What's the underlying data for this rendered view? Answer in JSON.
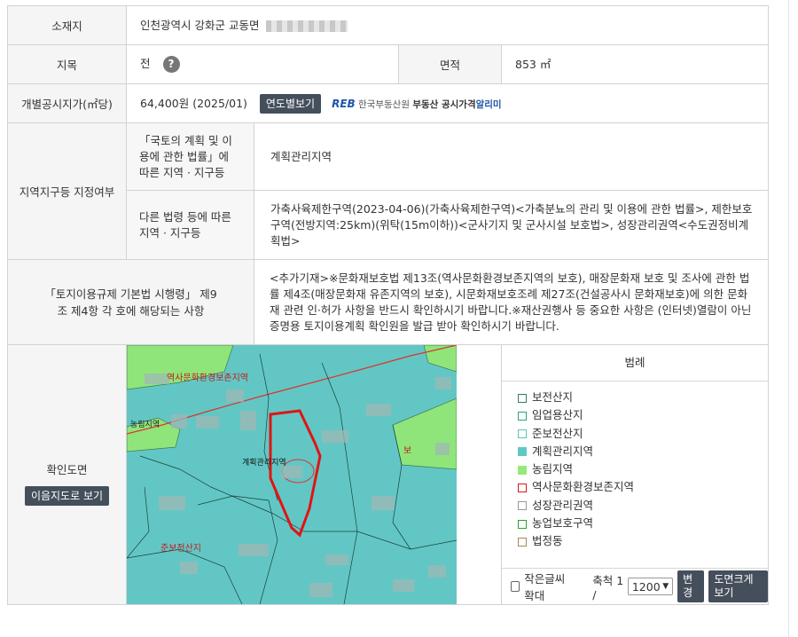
{
  "location": {
    "label": "소재지",
    "value": "인천광역시 강화군 교동면 "
  },
  "land": {
    "category_label": "지목",
    "category_value": "전",
    "help_glyph": "?",
    "area_label": "면적",
    "area_value": "853 ㎡"
  },
  "price": {
    "label": "개별공시지가(㎡당)",
    "value": "64,400원 (2025/01)",
    "yearly_button": "연도별보기",
    "provider_logo": "REB",
    "provider_name": "한국부동산원",
    "service_name": "부동산 공시가격",
    "service_brand": "알리미"
  },
  "zoning": {
    "label": "지역지구등 지정여부",
    "law_label": "「국토의 계획 및 이용에 관한 법률」에 따른 지역 · 지구등",
    "law_value": "계획관리지역",
    "other_label": "다른 법령 등에 따른 지역 · 지구등",
    "other_value": "가축사육제한구역(2023-04-06)(가축사육제한구역)<가축분뇨의 관리 및 이용에 관한 법률>, 제한보호구역(전방지역:25km)(위탁(15m이하))<군사기지 및 군사시설 보호법>, 성장관리권역<수도권정비계획법>"
  },
  "regulation": {
    "label": "「토지이용규제 기본법 시행령」 제9조 제4항 각 호에 해당되는 사항",
    "value": "<추가기재>※문화재보호법 제13조(역사문화환경보존지역의 보호), 매장문화재 보호 및 조사에 관한 법률 제4조(매장문화재 유존지역의 보호), 시문화재보호조례 제27조(건설공사시 문화재보호)에 의한 문화재 관련 인·허가 사항을 반드시 확인하시기 바랍니다.※재산권행사 등 중요한 사항은 (인터넷)열람이 아닌 증명용 토지이용계획 확인원을 발급 받아 확인하시기 바랍니다."
  },
  "map_section": {
    "label": "확인도면",
    "view_button": "이음지도로 보기",
    "map_labels": {
      "heritage": "역사문화환경보존지역",
      "farm": "농림지역",
      "plan": "계획관리지역",
      "preserve_mountain": "준보전산지",
      "farm_right": "보"
    }
  },
  "legend": {
    "title": "범례",
    "items": [
      {
        "label": "보전산지",
        "color": "#2f7f5e"
      },
      {
        "label": "임업용산지",
        "color": "#2aa37a"
      },
      {
        "label": "준보전산지",
        "color": "#58c7bd"
      },
      {
        "label": "계획관리지역",
        "color": "#5ec8c5",
        "filled": true
      },
      {
        "label": "농림지역",
        "color": "#98e87a",
        "filled": true
      },
      {
        "label": "역사문화환경보존지역",
        "color": "#d81b1b"
      },
      {
        "label": "성장관리권역",
        "color": "#9a9a9a"
      },
      {
        "label": "농업보호구역",
        "color": "#2f9e2f"
      },
      {
        "label": "법정동",
        "color": "#a08a5a"
      }
    ],
    "small_text_label": "작은글씨확대",
    "scale_label": "축척 1 /",
    "scale_value": "1200",
    "change_button": "변경",
    "enlarge_button": "도면크게보기"
  }
}
